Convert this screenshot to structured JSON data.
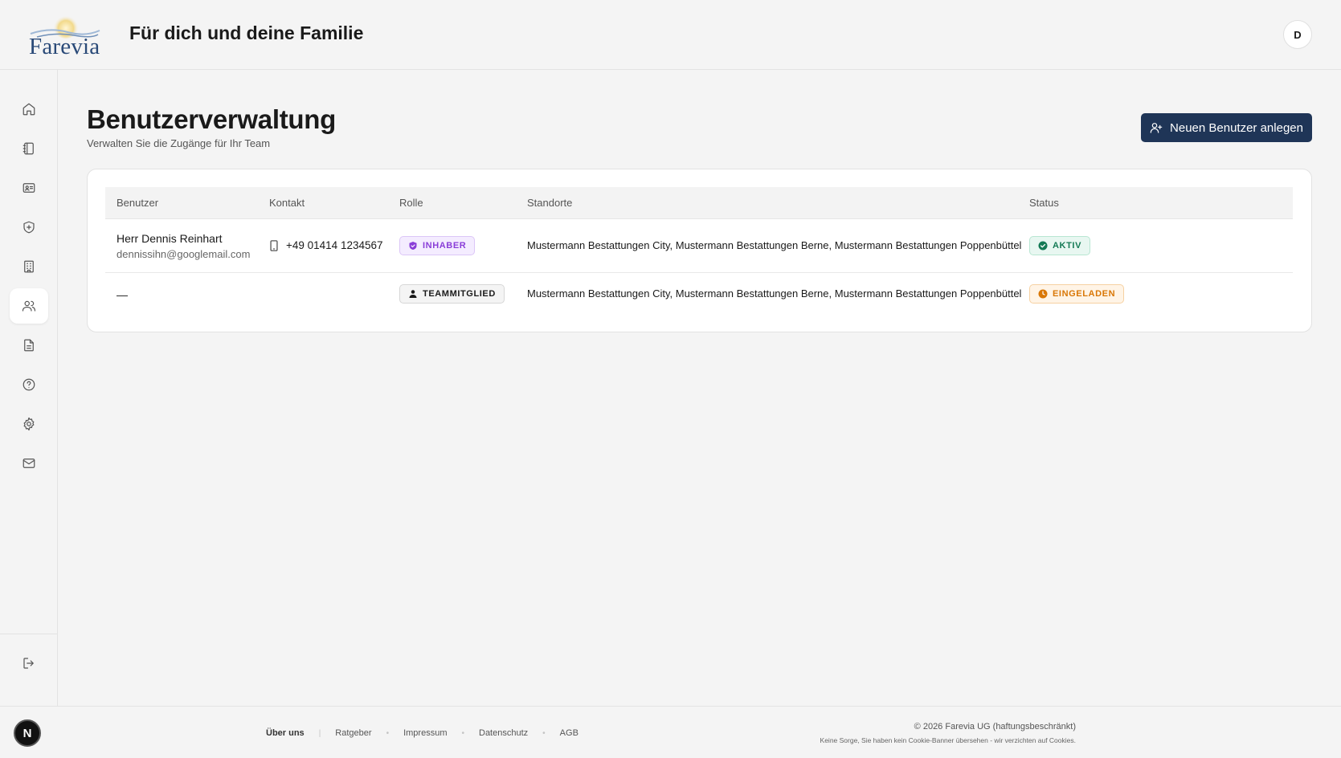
{
  "header": {
    "logo_text": "Farevia",
    "title": "Für dich und deine Familie",
    "avatar_initial": "D"
  },
  "sidebar": {
    "items": [
      {
        "icon": "home-icon",
        "active": false
      },
      {
        "icon": "notebook-icon",
        "active": false
      },
      {
        "icon": "id-card-icon",
        "active": false
      },
      {
        "icon": "shield-plus-icon",
        "active": false
      },
      {
        "icon": "building-icon",
        "active": false
      },
      {
        "icon": "users-icon",
        "active": true
      },
      {
        "icon": "document-icon",
        "active": false
      },
      {
        "icon": "help-circle-icon",
        "active": false
      },
      {
        "icon": "gear-icon",
        "active": false
      },
      {
        "icon": "mail-icon",
        "active": false
      }
    ],
    "logout_icon": "logout-icon"
  },
  "main": {
    "title": "Benutzerverwaltung",
    "subtitle": "Verwalten Sie die Zugänge für Ihr Team",
    "new_user_button": "Neuen Benutzer anlegen"
  },
  "table": {
    "columns": [
      "Benutzer",
      "Kontakt",
      "Rolle",
      "Standorte",
      "Status"
    ],
    "rows": [
      {
        "name": "Herr Dennis Reinhart",
        "email": "dennissihn@googlemail.com",
        "phone": "+49 01414 1234567",
        "role": "INHABER",
        "locations": "Mustermann Bestattungen City, Mustermann Bestattungen Berne, Mustermann Bestattungen Poppenbüttel",
        "status": "AKTIV"
      },
      {
        "name": "—",
        "email": "",
        "phone": "",
        "role": "TEAMMITGLIED",
        "locations": "Mustermann Bestattungen City, Mustermann Bestattungen Berne, Mustermann Bestattungen Poppenbüttel",
        "status": "EINGELADEN"
      }
    ]
  },
  "footer": {
    "badge": "N",
    "links": [
      "Über uns",
      "Ratgeber",
      "Impressum",
      "Datenschutz",
      "AGB"
    ],
    "copyright": "© 2026 Farevia UG (haftungsbeschränkt)",
    "cookie_note": "Keine Sorge, Sie haben kein Cookie-Banner übersehen - wir verzichten auf Cookies."
  },
  "colors": {
    "primary": "#1f3557",
    "owner": "#8a3ed8",
    "active": "#147a55",
    "invited": "#d97706"
  }
}
